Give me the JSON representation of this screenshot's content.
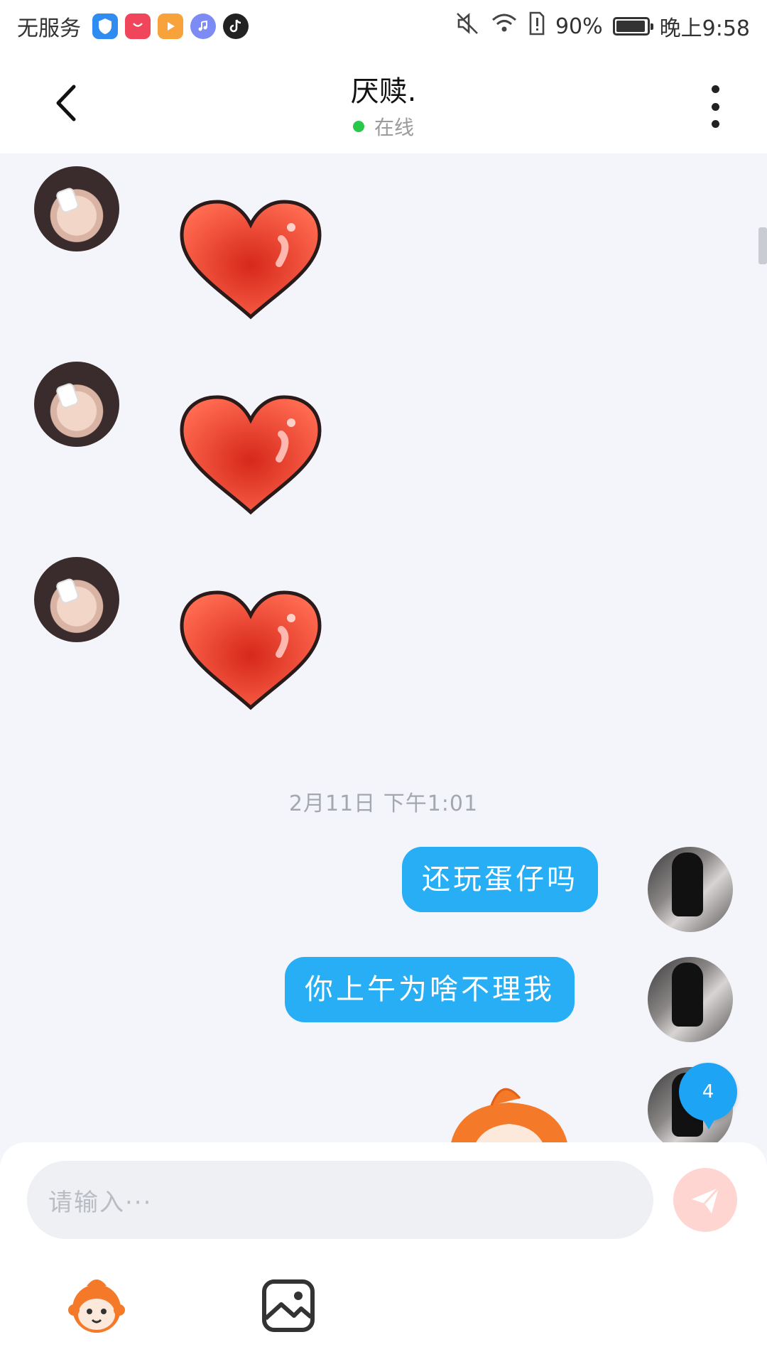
{
  "status_bar": {
    "carrier": "无服务",
    "battery": "90%",
    "time": "晚上9:58",
    "battery_level": 0.9,
    "app_icons": [
      "shield-app-icon",
      "huawei-store-icon",
      "video-app-icon",
      "music-app-icon",
      "tiktok-icon"
    ]
  },
  "header": {
    "title": "厌赎.",
    "status": "在线",
    "back_icon": "chevron-left-icon",
    "more_icon": "more-vertical-icon",
    "status_color": "#28c94a"
  },
  "chat": {
    "received": [
      {
        "type": "sticker",
        "content": "red-heart"
      },
      {
        "type": "sticker",
        "content": "red-heart"
      },
      {
        "type": "sticker",
        "content": "red-heart"
      }
    ],
    "timestamp": "2月11日  下午1:01",
    "sent": [
      {
        "type": "text",
        "text": "还玩蛋仔吗"
      },
      {
        "type": "text",
        "text": "你上午为啥不理我"
      },
      {
        "type": "sticker",
        "content": "cartoon-character"
      }
    ],
    "unread_badge": "4",
    "bubble_color": "#27aef5"
  },
  "input": {
    "placeholder": "请输入···",
    "send_icon": "paper-plane-icon",
    "tools": [
      "emoji-sticker-icon",
      "image-icon"
    ]
  }
}
